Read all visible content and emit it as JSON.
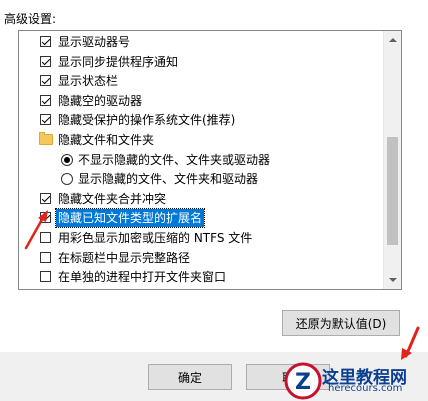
{
  "section_label": "高级设置:",
  "tree_items": [
    {
      "type": "checkbox",
      "checked": true,
      "label": "显示驱动器号"
    },
    {
      "type": "checkbox",
      "checked": true,
      "label": "显示同步提供程序通知"
    },
    {
      "type": "checkbox",
      "checked": true,
      "label": "显示状态栏"
    },
    {
      "type": "checkbox",
      "checked": true,
      "label": "隐藏空的驱动器"
    },
    {
      "type": "checkbox",
      "checked": true,
      "label": "隐藏受保护的操作系统文件(推荐)"
    },
    {
      "type": "folder",
      "label": "隐藏文件和文件夹"
    },
    {
      "type": "radio",
      "checked": true,
      "label": "不显示隐藏的文件、文件夹或驱动器"
    },
    {
      "type": "radio",
      "checked": false,
      "label": "显示隐藏的文件、文件夹和驱动器"
    },
    {
      "type": "checkbox",
      "checked": true,
      "label": "隐藏文件夹合并冲突"
    },
    {
      "type": "checkbox",
      "checked": true,
      "selected": true,
      "label": "隐藏已知文件类型的扩展名"
    },
    {
      "type": "checkbox",
      "checked": false,
      "label": "用彩色显示加密或压缩的 NTFS 文件"
    },
    {
      "type": "checkbox",
      "checked": false,
      "label": "在标题栏中显示完整路径"
    },
    {
      "type": "checkbox",
      "checked": false,
      "label": "在单独的进程中打开文件夹窗口"
    }
  ],
  "buttons": {
    "restore_defaults": "还原为默认值(D)",
    "ok": "确定",
    "cancel": "取"
  },
  "watermark": {
    "title": "这里教程网",
    "url": "herecours.com",
    "logo_letter": "Z"
  },
  "colors": {
    "selection": "#0078d7",
    "annotation": "#e0241b"
  }
}
